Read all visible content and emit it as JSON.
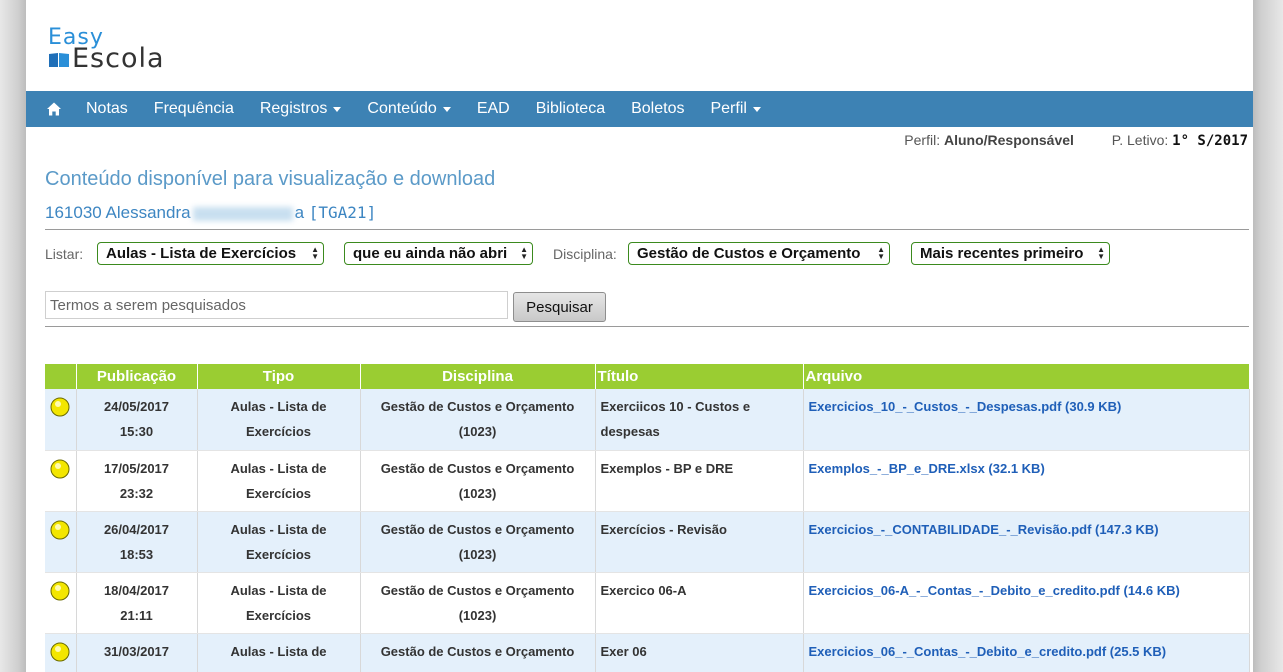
{
  "logo": {
    "line1": "Easy",
    "line2": "Escola"
  },
  "nav": {
    "items": [
      {
        "label": "Notas",
        "dropdown": false
      },
      {
        "label": "Frequência",
        "dropdown": false
      },
      {
        "label": "Registros",
        "dropdown": true
      },
      {
        "label": "Conteúdo",
        "dropdown": true
      },
      {
        "label": "EAD",
        "dropdown": false
      },
      {
        "label": "Biblioteca",
        "dropdown": false
      },
      {
        "label": "Boletos",
        "dropdown": false
      },
      {
        "label": "Perfil",
        "dropdown": true
      }
    ]
  },
  "profile": {
    "perfil_label": "Perfil:",
    "perfil_value": "Aluno/Responsável",
    "letivo_label": "P. Letivo:",
    "letivo_value": "1° S/2017"
  },
  "page": {
    "title": "Conteúdo disponível para visualização e download",
    "student_prefix": "161030 Alessandra",
    "student_suffix": "a",
    "student_class": "[TGA21]"
  },
  "filters": {
    "listar_label": "Listar:",
    "listar_value": "Aulas - Lista de Exercícios",
    "status_value": "que eu ainda não abri",
    "disciplina_label": "Disciplina:",
    "disciplina_value": "Gestão de Custos e Orçamento",
    "order_value": "Mais recentes primeiro"
  },
  "search": {
    "placeholder": "Termos a serem pesquisados",
    "button_label": "Pesquisar"
  },
  "table": {
    "headers": [
      "",
      "Publicação",
      "Tipo",
      "Disciplina",
      "Título",
      "Arquivo"
    ],
    "rows": [
      {
        "date": "24/05/2017",
        "time": "15:30",
        "tipo1": "Aulas - Lista de",
        "tipo2": "Exercícios",
        "disc1": "Gestão de Custos e Orçamento",
        "disc2": "(1023)",
        "titulo": "Exerciicos 10 - Custos e despesas",
        "arquivo": "Exercicios_10_-_Custos_-_Despesas.pdf (30.9 KB)"
      },
      {
        "date": "17/05/2017",
        "time": "23:32",
        "tipo1": "Aulas - Lista de",
        "tipo2": "Exercícios",
        "disc1": "Gestão de Custos e Orçamento",
        "disc2": "(1023)",
        "titulo": "Exemplos - BP e DRE",
        "arquivo": "Exemplos_-_BP_e_DRE.xlsx (32.1 KB)"
      },
      {
        "date": "26/04/2017",
        "time": "18:53",
        "tipo1": "Aulas - Lista de",
        "tipo2": "Exercícios",
        "disc1": "Gestão de Custos e Orçamento",
        "disc2": "(1023)",
        "titulo": "Exercícios - Revisão",
        "arquivo": "Exercicios_-_CONTABILIDADE_-_Revisão.pdf (147.3 KB)"
      },
      {
        "date": "18/04/2017",
        "time": "21:11",
        "tipo1": "Aulas - Lista de",
        "tipo2": "Exercícios",
        "disc1": "Gestão de Custos e Orçamento",
        "disc2": "(1023)",
        "titulo": "Exercico 06-A",
        "arquivo": "Exercicios_06-A_-_Contas_-_Debito_e_credito.pdf (14.6 KB)"
      },
      {
        "date": "31/03/2017",
        "time": "",
        "tipo1": "Aulas - Lista de",
        "tipo2": "",
        "disc1": "Gestão de Custos e Orçamento",
        "disc2": "",
        "titulo": "Exer 06",
        "arquivo": "Exercicios_06_-_Contas_-_Debito_e_credito.pdf (25.5 KB)"
      }
    ]
  },
  "colors": {
    "nav_bg": "#3d82b4",
    "header_green": "#9acd32",
    "row_blue": "#e4f0fb",
    "link": "#1f5fb8",
    "title_blue": "#5b9ac8"
  }
}
